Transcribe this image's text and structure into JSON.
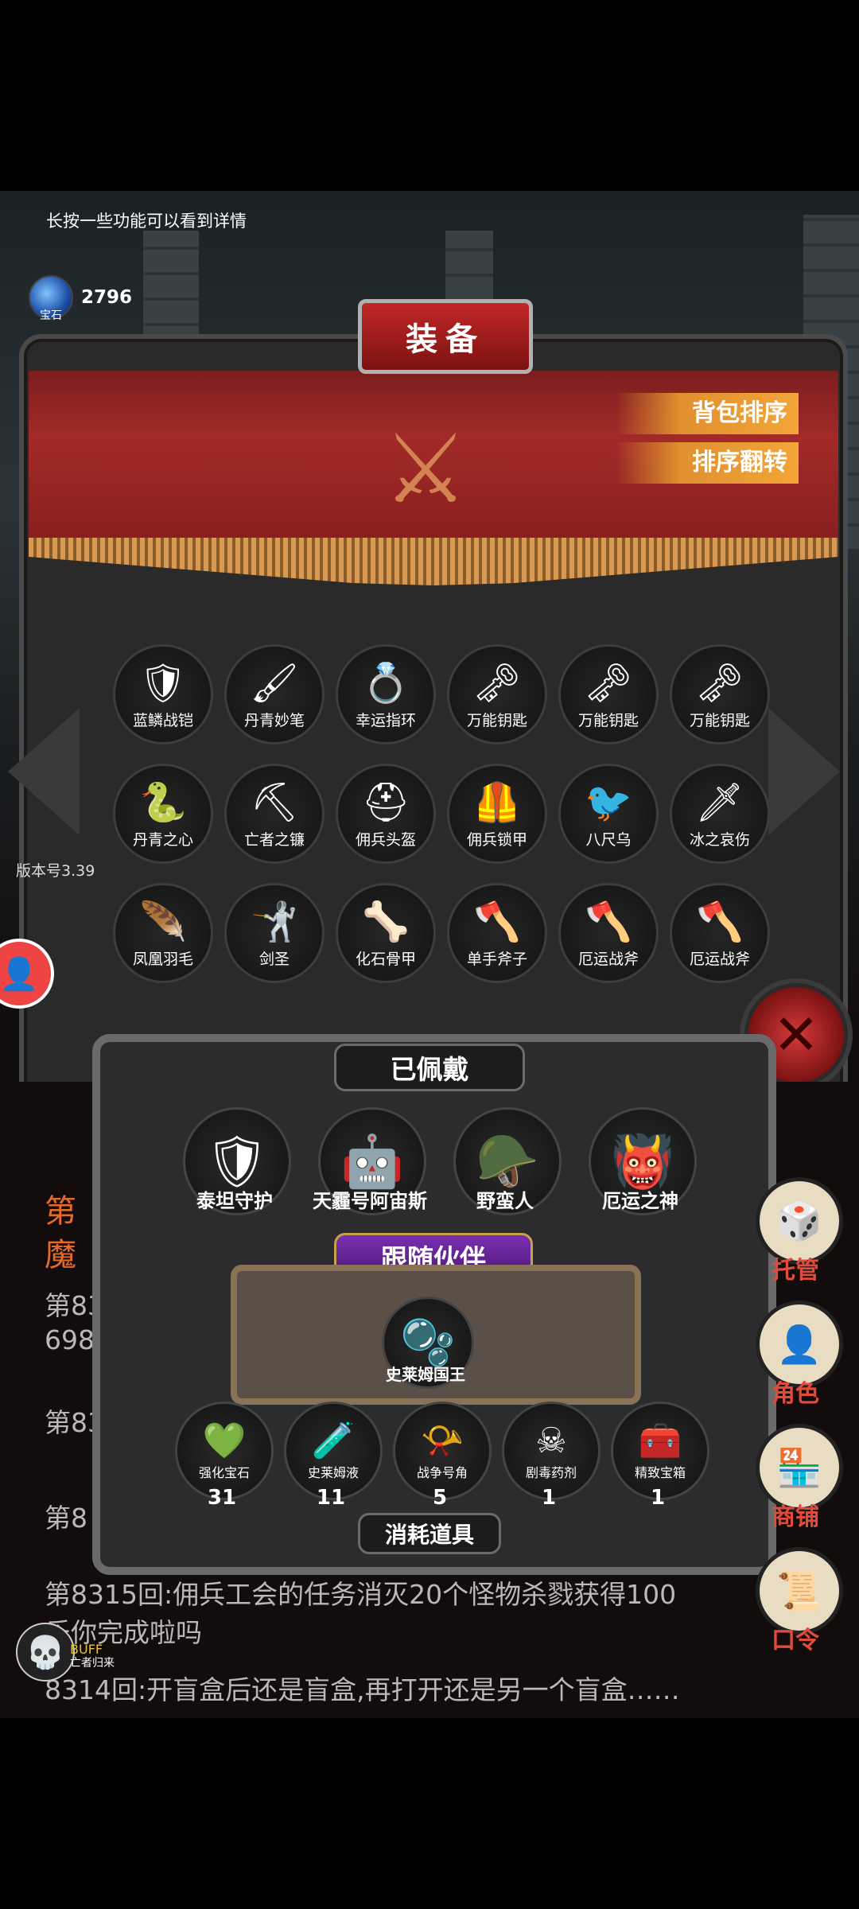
{
  "hint": "长按一些功能可以看到详情",
  "currency": {
    "icon": "blue-gem-icon",
    "label": "宝石",
    "count": "2796"
  },
  "version": "版本号3.39",
  "panel": {
    "title": "装备",
    "sort_pack": "背包排序",
    "sort_reverse": "排序翻转"
  },
  "inventory": [
    {
      "label": "蓝鳞战铠",
      "icon": "armor-icon",
      "glyph": "🛡"
    },
    {
      "label": "丹青妙笔",
      "icon": "brush-icon",
      "glyph": "🖌"
    },
    {
      "label": "幸运指环",
      "icon": "ring-icon",
      "glyph": "💍"
    },
    {
      "label": "万能钥匙",
      "icon": "key-icon",
      "glyph": "🗝"
    },
    {
      "label": "万能钥匙",
      "icon": "key-icon",
      "glyph": "🗝"
    },
    {
      "label": "万能钥匙",
      "icon": "key-icon",
      "glyph": "🗝"
    },
    {
      "label": "丹青之心",
      "icon": "heart-scroll-icon",
      "glyph": "🐍"
    },
    {
      "label": "亡者之镰",
      "icon": "scythe-icon",
      "glyph": "⛏"
    },
    {
      "label": "佣兵头盔",
      "icon": "helmet-icon",
      "glyph": "⛑"
    },
    {
      "label": "佣兵锁甲",
      "icon": "chainmail-icon",
      "glyph": "🦺"
    },
    {
      "label": "八尺乌",
      "icon": "crow-icon",
      "glyph": "🐦"
    },
    {
      "label": "冰之哀伤",
      "icon": "ice-sword-icon",
      "glyph": "🗡"
    },
    {
      "label": "凤凰羽毛",
      "icon": "feather-icon",
      "glyph": "🪶"
    },
    {
      "label": "剑圣",
      "icon": "swordsman-icon",
      "glyph": "🤺"
    },
    {
      "label": "化石骨甲",
      "icon": "bone-armor-icon",
      "glyph": "🦴"
    },
    {
      "label": "单手斧子",
      "icon": "axe-icon",
      "glyph": "🪓"
    },
    {
      "label": "厄运战斧",
      "icon": "war-axe-icon",
      "glyph": "🪓"
    },
    {
      "label": "厄运战斧",
      "icon": "war-axe-icon",
      "glyph": "🪓"
    }
  ],
  "equipped": {
    "title": "已佩戴",
    "items": [
      {
        "label": "泰坦守护",
        "icon": "titan-icon",
        "glyph": "🛡"
      },
      {
        "label": "天霾号阿宙斯",
        "icon": "mech-icon",
        "glyph": "🤖"
      },
      {
        "label": "野蛮人",
        "icon": "barbarian-icon",
        "glyph": "🪖"
      },
      {
        "label": "厄运之神",
        "icon": "doom-god-icon",
        "glyph": "👹"
      }
    ]
  },
  "companion": {
    "title": "跟随伙伴",
    "label": "史莱姆国王",
    "icon": "slime-icon",
    "glyph": "🫧"
  },
  "consumables": {
    "title": "消耗道具",
    "items": [
      {
        "label": "强化宝石",
        "icon": "green-gem-icon",
        "glyph": "💚",
        "count": "31"
      },
      {
        "label": "史莱姆液",
        "icon": "potion-icon",
        "glyph": "🧪",
        "count": "11"
      },
      {
        "label": "战争号角",
        "icon": "horn-icon",
        "glyph": "📯",
        "count": "5"
      },
      {
        "label": "剧毒药剂",
        "icon": "poison-icon",
        "glyph": "☠",
        "count": "1"
      },
      {
        "label": "精致宝箱",
        "icon": "chest-icon",
        "glyph": "🧰",
        "count": "1"
      }
    ]
  },
  "side_menu": [
    {
      "label": "托管",
      "icon": "dice-icon",
      "glyph": "🎲"
    },
    {
      "label": "角色",
      "icon": "hooded-figure-icon",
      "glyph": "👤"
    },
    {
      "label": "商铺",
      "icon": "shop-icon",
      "glyph": "🏪"
    },
    {
      "label": "口令",
      "icon": "scroll-icon",
      "glyph": "📜"
    }
  ],
  "log": {
    "line1": "第831",
    "line2": "698",
    "line3": "第83",
    "line4": "第8",
    "line5": "第8315回:佣兵工会的任务消灭20个怪物杀戮获得100",
    "line6": "乐你完成啦吗",
    "line7": "8314回:开盲盒后还是盲盒,再打开还是另一个盲盒……",
    "line_left_a": "第",
    "line_left_b": "魔"
  },
  "buff": {
    "label": "BUFF",
    "sub": "亡者归来"
  }
}
